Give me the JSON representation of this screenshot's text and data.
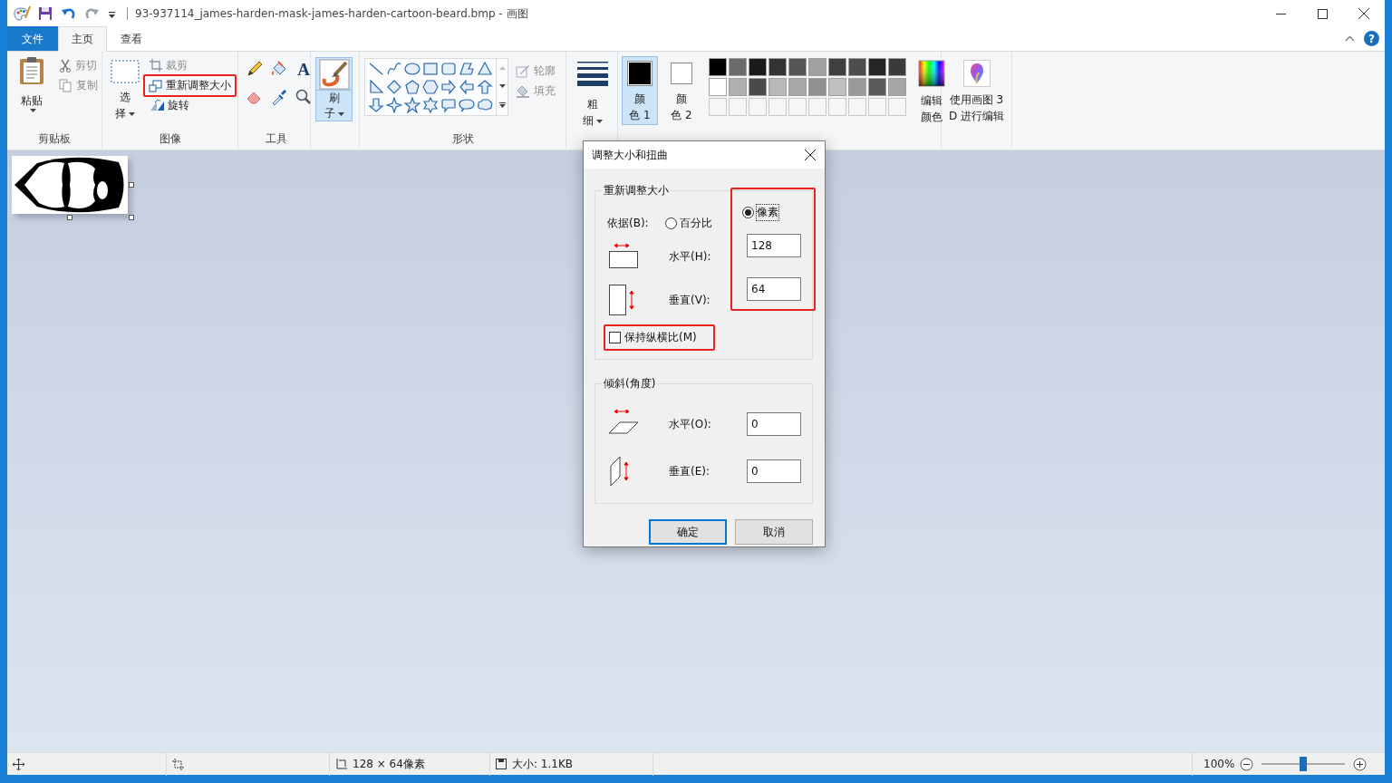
{
  "window": {
    "title": "93-937114_james-harden-mask-james-harden-cartoon-beard.bmp - 画图"
  },
  "tabs": [
    {
      "label": "文件",
      "kind": "file",
      "selected": false
    },
    {
      "label": "主页",
      "kind": "tab",
      "selected": true
    },
    {
      "label": "查看",
      "kind": "tab",
      "selected": false
    }
  ],
  "help": "?",
  "ribbon": {
    "clipboard": {
      "label": "剪贴板",
      "paste": "粘贴",
      "cut": {
        "label": "剪切",
        "disabled": true
      },
      "copy": {
        "label": "复制",
        "disabled": true
      }
    },
    "image": {
      "label": "图像",
      "select": [
        "选",
        "择"
      ],
      "crop": {
        "label": "裁剪",
        "disabled": true
      },
      "resize": {
        "label": "重新调整大小",
        "disabled": false,
        "highlighted": true
      },
      "rotate": {
        "label": "旋转",
        "disabled": false
      }
    },
    "tools": {
      "label": "工具",
      "text_glyph": "A"
    },
    "brushes": {
      "label": [
        "刷",
        "子"
      ],
      "selected": true
    },
    "shapes": {
      "label": "形状",
      "outline": {
        "label": "轮廓",
        "disabled": true
      },
      "fill": {
        "label": "填充",
        "disabled": true
      }
    },
    "size": {
      "label": [
        "粗",
        "细"
      ]
    },
    "color1": {
      "label": [
        "颜",
        "色 1"
      ],
      "color": "#000000",
      "selected": true
    },
    "color2": {
      "label": [
        "颜",
        "色 2"
      ],
      "color": "#ffffff",
      "selected": false
    },
    "palette": [
      [
        {
          "color": "#000000"
        },
        {
          "color": "#6b6b6b"
        },
        {
          "color": "#1a1a1a"
        },
        {
          "color": "#333333"
        },
        {
          "color": "#555555"
        },
        {
          "color": "#a0a0a0"
        },
        {
          "color": "#404040"
        },
        {
          "color": "#4d4d4d"
        },
        {
          "color": "#262626"
        },
        {
          "color": "#3a3a3a"
        }
      ],
      [
        {
          "color": "#ffffff"
        },
        {
          "color": "#b0b0b0"
        },
        {
          "color": "#4a4a4a"
        },
        {
          "color": "#b8b8b8"
        },
        {
          "color": "#a8a8a8"
        },
        {
          "color": "#909090"
        },
        {
          "color": "#c0c0c0"
        },
        {
          "color": "#9a9a9a"
        },
        {
          "color": "#5a5a5a"
        },
        {
          "color": "#a5a5a5"
        }
      ]
    ],
    "edit_colors": [
      "编辑",
      "颜色"
    ],
    "paint3d": [
      "使用画图 3",
      "D 进行编辑"
    ]
  },
  "status_bar": {
    "image_size": "128 × 64像素",
    "file_size": "大小: 1.1KB",
    "zoom": "100%",
    "zoom_slider": {
      "level": 0.5
    }
  },
  "dialog": {
    "title": "调整大小和扭曲",
    "resize": {
      "label": "重新调整大小",
      "by_label": "依据(B):",
      "highlighted": true,
      "options": [
        {
          "label": "百分比",
          "selected": false
        },
        {
          "label": "像素",
          "selected": true
        }
      ],
      "horizontal": {
        "label": "水平(H):",
        "value": "128"
      },
      "vertical": {
        "label": "垂直(V):",
        "value": "64"
      },
      "keep_ratio": {
        "label": "保持纵横比(M)",
        "checked": false,
        "highlighted": true
      }
    },
    "skew": {
      "label": "倾斜(角度)",
      "horizontal": {
        "label": "水平(O):",
        "value": "0"
      },
      "vertical": {
        "label": "垂直(E):",
        "value": "0"
      }
    },
    "buttons": [
      {
        "label": "确定",
        "default": true
      },
      {
        "label": "取消",
        "default": false
      }
    ]
  }
}
